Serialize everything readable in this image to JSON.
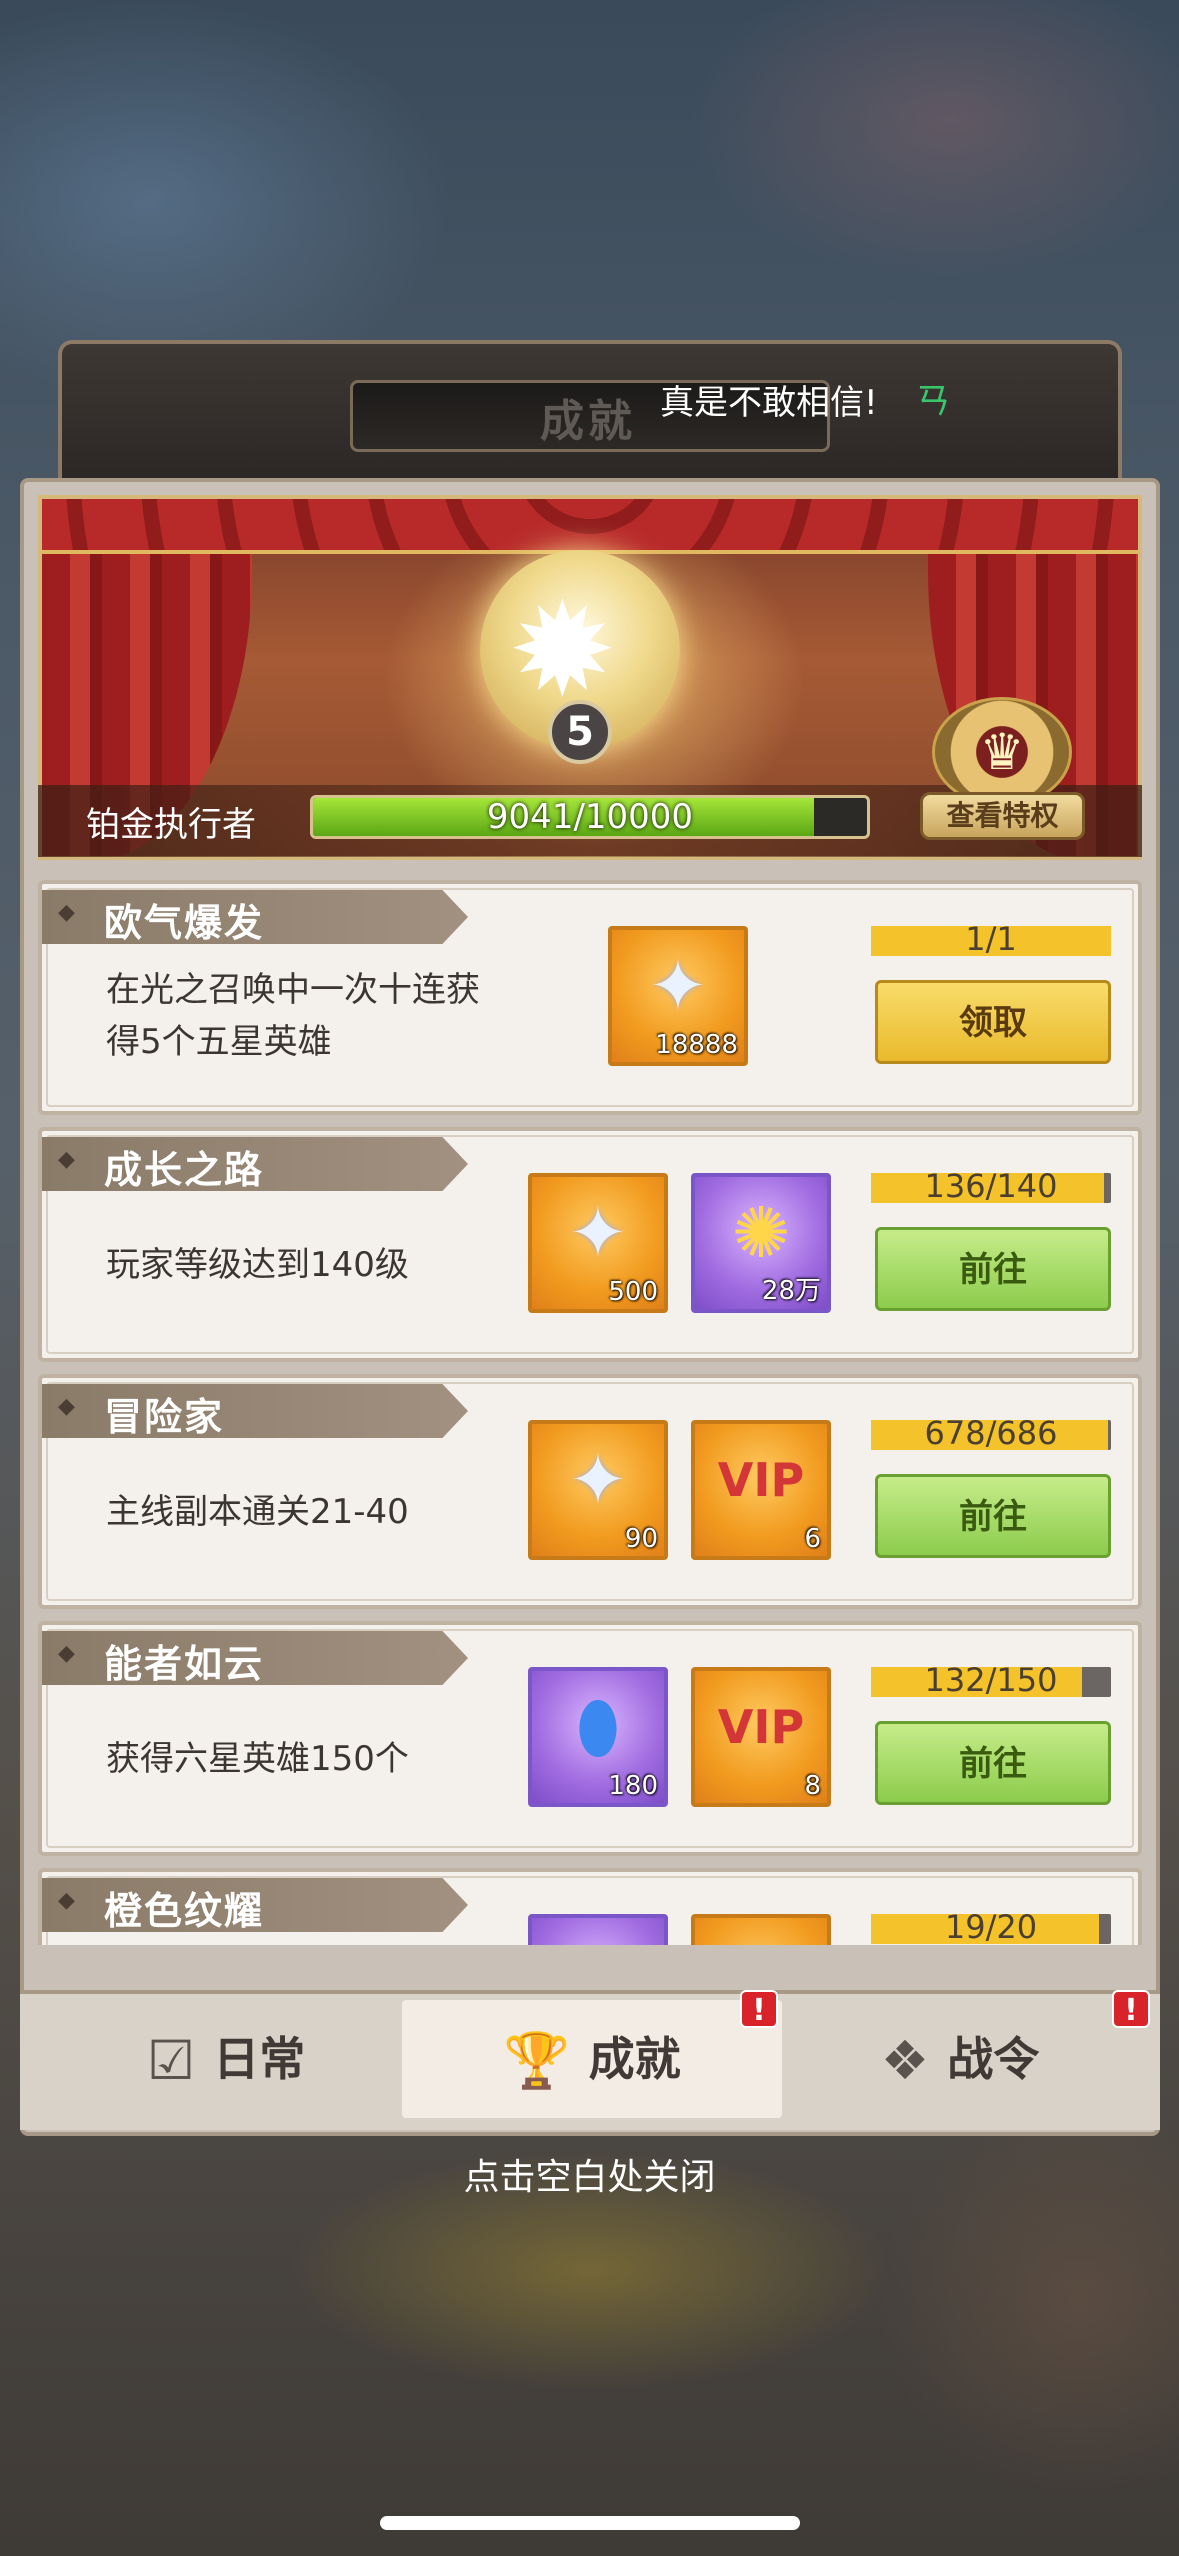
{
  "header": {
    "title": "成就",
    "toast": "真是不敢相信!",
    "toast_icon": "ㄢ"
  },
  "banner": {
    "medal_level": "5",
    "rank_name": "铂金执行者",
    "xp_text": "9041/10000",
    "xp_fraction": 0.9041,
    "privilege_button": "查看特权"
  },
  "achievements": [
    {
      "title": "欧气爆发",
      "description": "在光之召唤中一次十连获得5个五星英雄",
      "rewards": [
        {
          "icon": "diamond-icon",
          "qty": "18888",
          "frame": "orange"
        }
      ],
      "progress_text": "1/1",
      "progress_fraction": 1.0,
      "button": "领取",
      "button_style": "claim"
    },
    {
      "title": "成长之路",
      "description": "玩家等级达到140级",
      "rewards": [
        {
          "icon": "diamond-icon",
          "qty": "500",
          "frame": "orange"
        },
        {
          "icon": "gold-coin-icon",
          "qty": "28万",
          "frame": "purple"
        }
      ],
      "progress_text": "136/140",
      "progress_fraction": 0.971,
      "button": "前往",
      "button_style": "go"
    },
    {
      "title": "冒险家",
      "description": "主线副本通关21-40",
      "rewards": [
        {
          "icon": "diamond-icon",
          "qty": "90",
          "frame": "orange"
        },
        {
          "icon": "vip-badge-icon",
          "qty": "6",
          "frame": "orange"
        }
      ],
      "progress_text": "678/686",
      "progress_fraction": 0.988,
      "button": "前往",
      "button_style": "go"
    },
    {
      "title": "能者如云",
      "description": "获得六星英雄150个",
      "rewards": [
        {
          "icon": "blue-crystal-icon",
          "qty": "180",
          "frame": "purple"
        },
        {
          "icon": "vip-badge-icon",
          "qty": "8",
          "frame": "orange"
        }
      ],
      "progress_text": "132/150",
      "progress_fraction": 0.88,
      "button": "前往",
      "button_style": "go"
    },
    {
      "title": "橙色纹耀",
      "description": "",
      "rewards": [
        {
          "icon": "reward-icon",
          "qty": "",
          "frame": "purple"
        },
        {
          "icon": "reward-icon",
          "qty": "",
          "frame": "orange"
        }
      ],
      "progress_text": "19/20",
      "progress_fraction": 0.95,
      "button": "",
      "button_style": "go"
    }
  ],
  "tabs": [
    {
      "label": "日常",
      "icon": "checklist-icon",
      "active": false,
      "alert": ""
    },
    {
      "label": "成就",
      "icon": "trophy-icon",
      "active": true,
      "alert": "!"
    },
    {
      "label": "战令",
      "icon": "battle-pass-icon",
      "active": false,
      "alert": "!"
    }
  ],
  "close_hint": "点击空白处关闭"
}
